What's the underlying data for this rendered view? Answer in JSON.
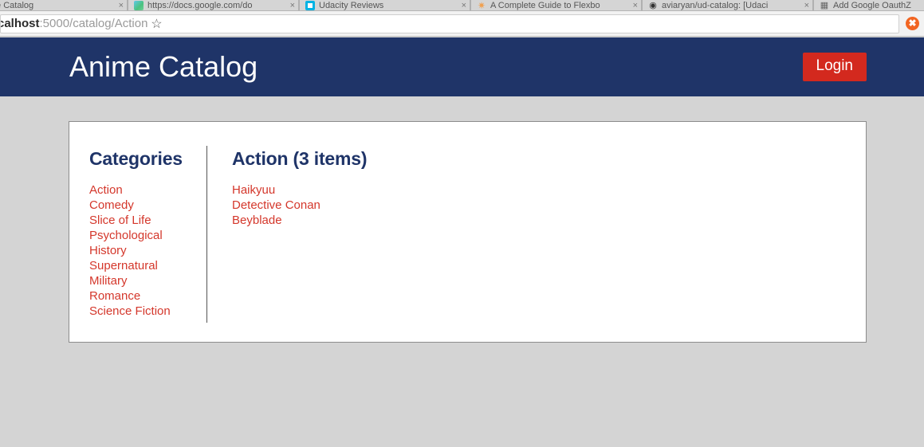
{
  "browser": {
    "tabs": [
      {
        "title": "Anime Catalog",
        "favicon": "blank-favicon",
        "close": "×",
        "active": false
      },
      {
        "title": "https://docs.google.com/do",
        "favicon": "google-docs-favicon",
        "close": "×",
        "active": false
      },
      {
        "title": "Udacity Reviews",
        "favicon": "udacity-favicon",
        "close": "×",
        "active": false
      },
      {
        "title": "A Complete Guide to Flexbo",
        "favicon": "css-tricks-favicon",
        "close": "×",
        "active": false
      },
      {
        "title": "aviaryan/ud-catalog: [Udaci",
        "favicon": "github-favicon",
        "close": "×",
        "active": false
      },
      {
        "title": "Add Google OauthZ",
        "favicon": "document-favicon",
        "close": "×",
        "active": false
      }
    ],
    "url_host": "calhost",
    "url_path": ":5000/catalog/Action",
    "star_glyph": "☆",
    "extension_glyph": "✖"
  },
  "header": {
    "brand": "Anime Catalog",
    "login_label": "Login"
  },
  "categories": {
    "heading": "Categories",
    "items": [
      {
        "label": "Action"
      },
      {
        "label": "Comedy"
      },
      {
        "label": "Slice of Life"
      },
      {
        "label": "Psychological"
      },
      {
        "label": "History"
      },
      {
        "label": "Supernatural"
      },
      {
        "label": "Military"
      },
      {
        "label": "Romance"
      },
      {
        "label": "Science Fiction"
      }
    ]
  },
  "items_pane": {
    "heading": "Action (3 items)",
    "items": [
      {
        "label": "Haikyuu"
      },
      {
        "label": "Detective Conan"
      },
      {
        "label": "Beyblade"
      }
    ]
  },
  "colors": {
    "header_navy": "#1f3468",
    "link_red": "#d4372b",
    "login_red": "#d3291e",
    "page_background": "#d4d4d4",
    "card_background": "#ffffff"
  }
}
